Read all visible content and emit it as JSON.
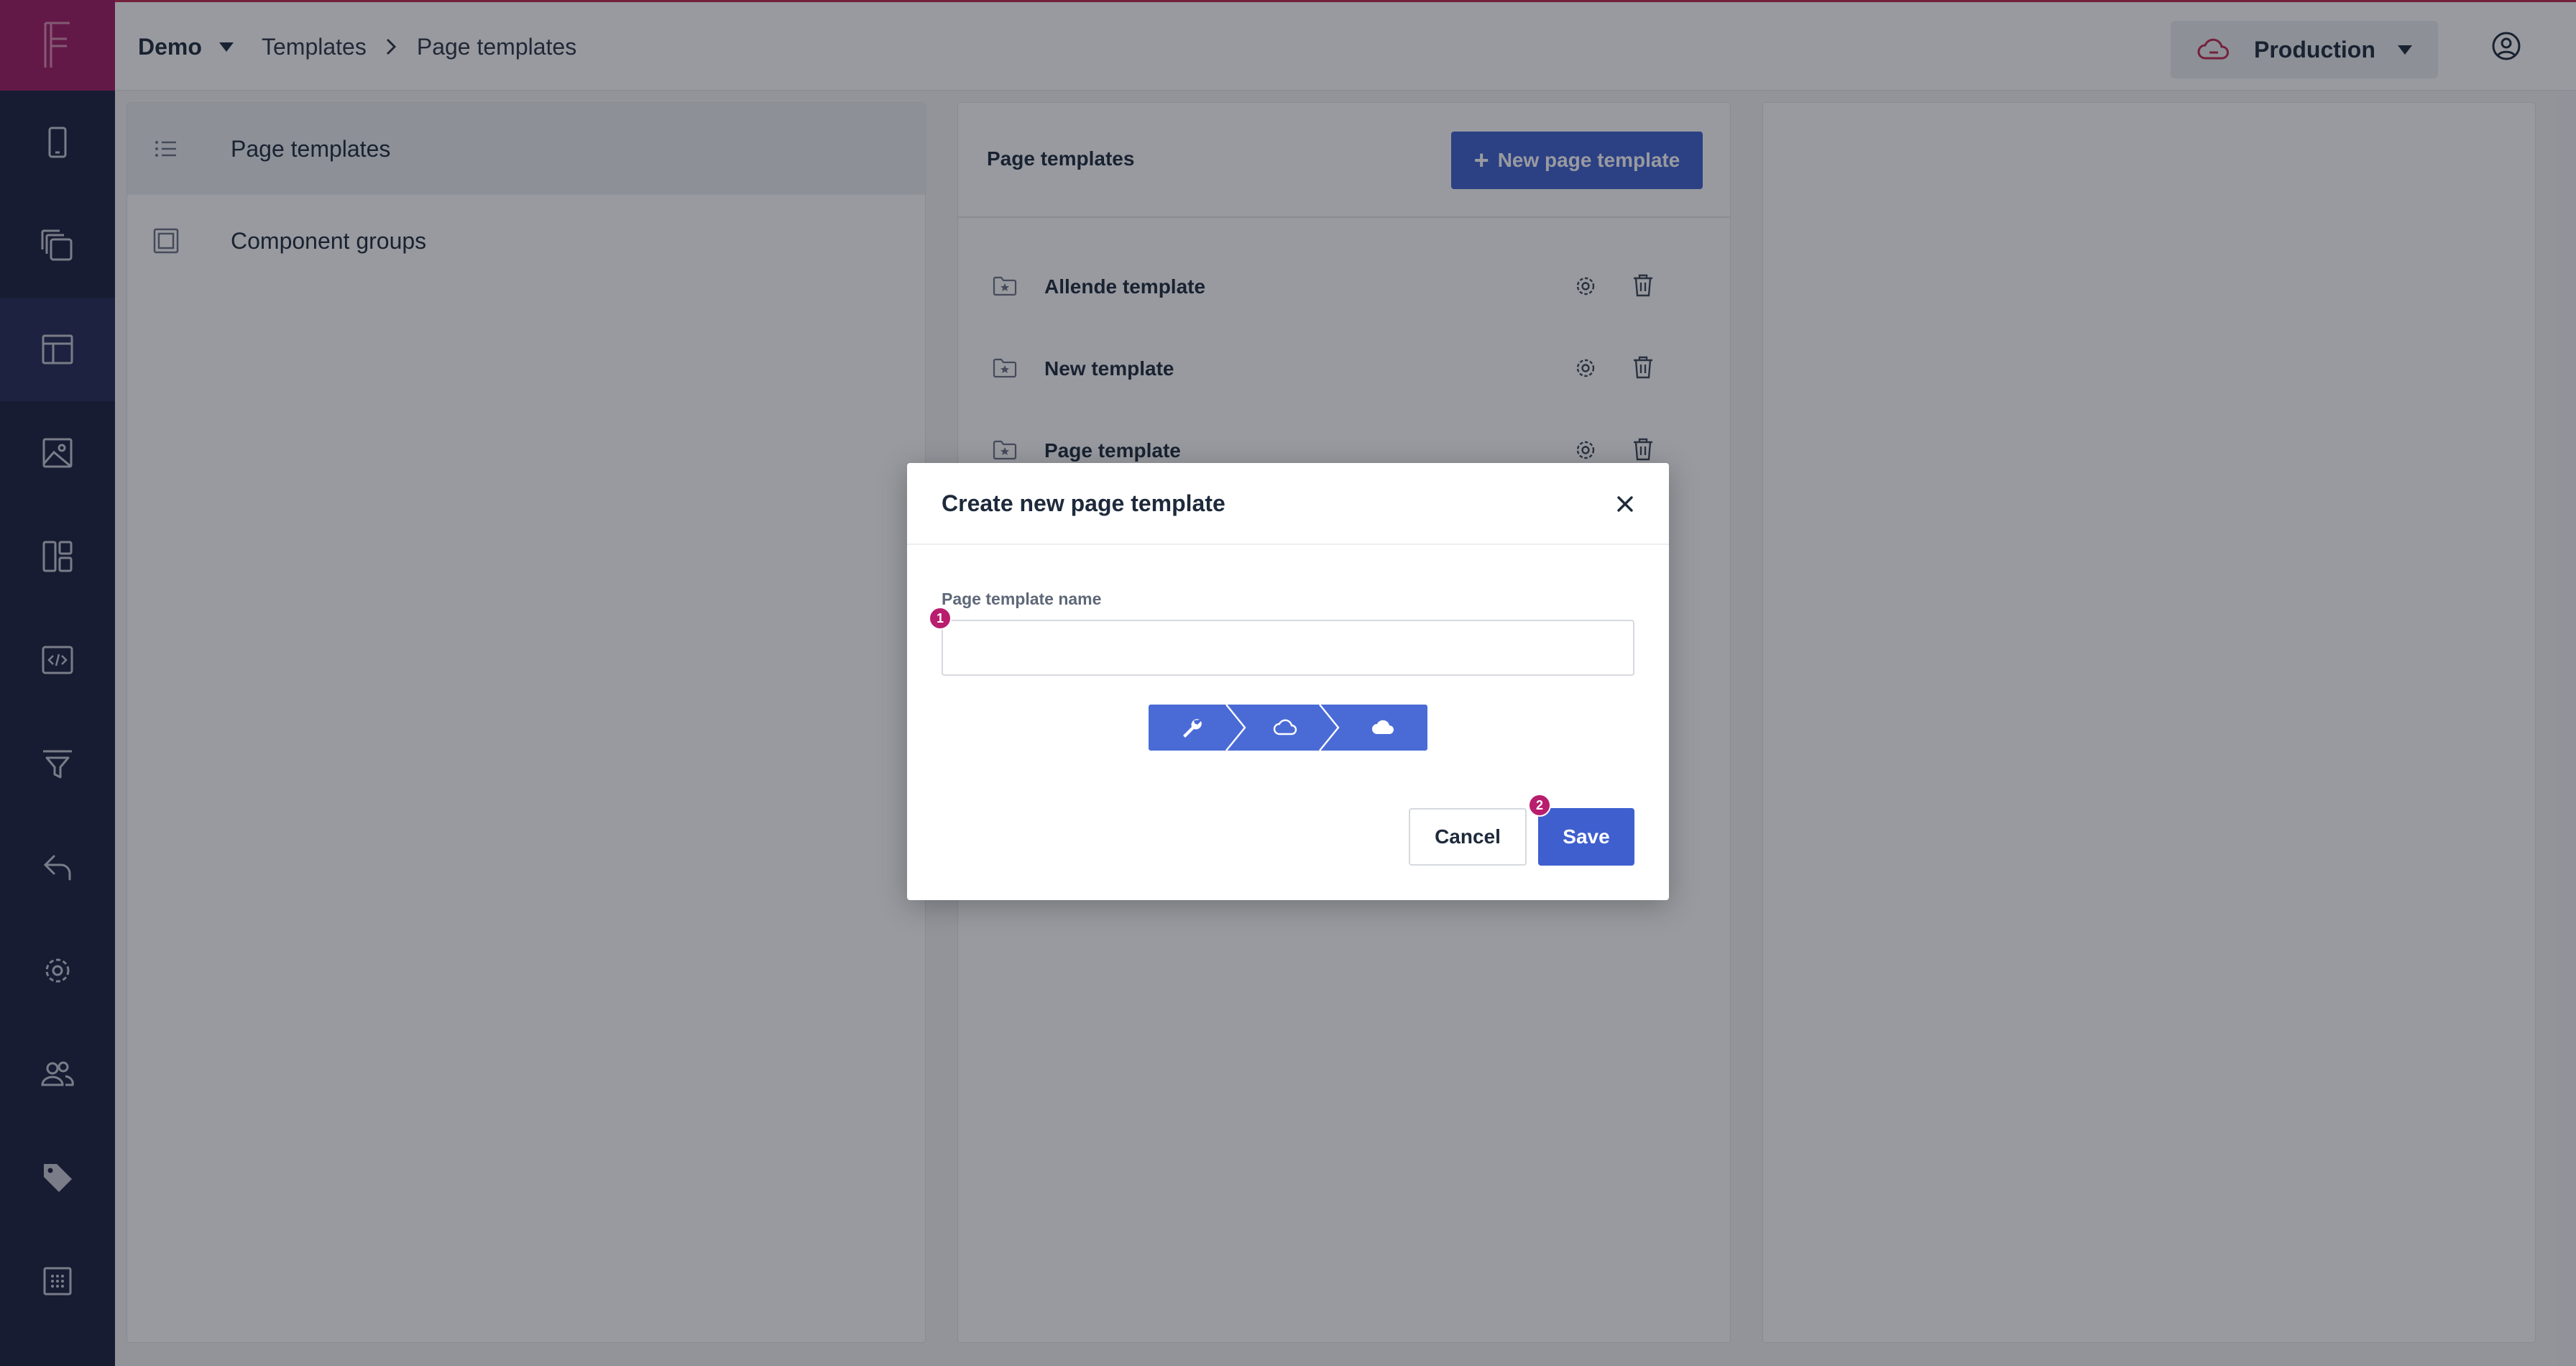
{
  "colors": {
    "rail_bg": "#1a1f3f",
    "logo_bg": "#a01a62",
    "accent_blue": "#3f5fcf",
    "marker_pink": "#b81d6e",
    "env_cloud_red": "#c0284e"
  },
  "rail": {
    "logo": "F",
    "items": [
      {
        "icon": "device-icon"
      },
      {
        "icon": "layers-icon"
      },
      {
        "icon": "layout-icon",
        "active": true
      },
      {
        "icon": "image-icon"
      },
      {
        "icon": "dashboard-icon"
      },
      {
        "icon": "code-icon"
      },
      {
        "icon": "filter-icon"
      },
      {
        "icon": "undo-icon"
      },
      {
        "icon": "settings-icon"
      },
      {
        "icon": "users-icon"
      },
      {
        "icon": "tag-icon"
      },
      {
        "icon": "grid-icon"
      }
    ]
  },
  "topbar": {
    "space_name": "Demo",
    "breadcrumb": [
      "Templates",
      "Page templates"
    ],
    "environment": "Production"
  },
  "sidebar": {
    "items": [
      {
        "label": "Page templates",
        "icon": "list-icon",
        "active": true
      },
      {
        "label": "Component groups",
        "icon": "square-icon",
        "active": false
      }
    ]
  },
  "list": {
    "title": "Page templates",
    "new_button": "New page template",
    "new_button_icon": "+",
    "templates": [
      {
        "name": "Allende template"
      },
      {
        "name": "New template"
      },
      {
        "name": "Page template"
      }
    ]
  },
  "modal": {
    "title": "Create new page template",
    "field_label": "Page template name",
    "field_value": "",
    "steps": [
      {
        "icon": "wrench-icon"
      },
      {
        "icon": "cloud-outline-icon"
      },
      {
        "icon": "cloud-filled-icon"
      }
    ],
    "cancel_label": "Cancel",
    "save_label": "Save",
    "markers": [
      "1",
      "2"
    ]
  }
}
